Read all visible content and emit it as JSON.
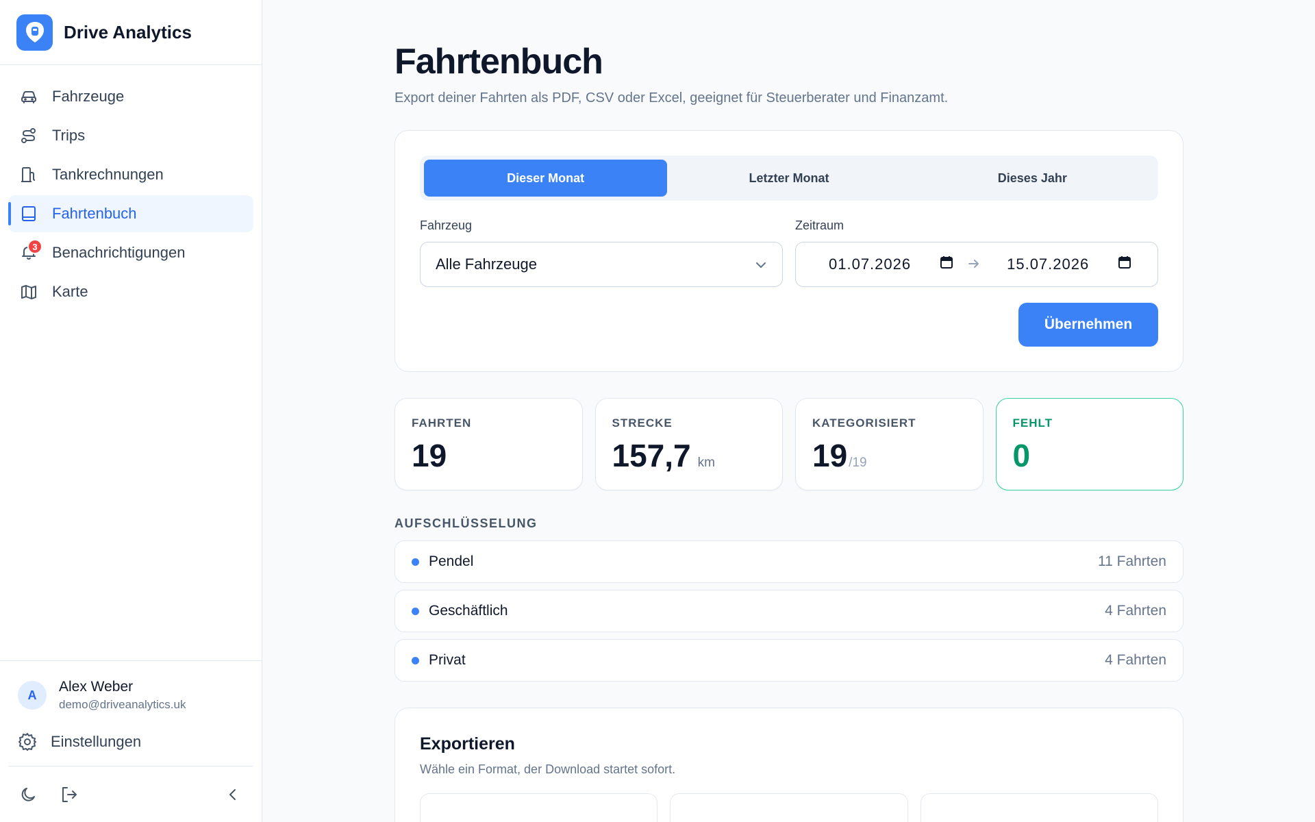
{
  "app": {
    "name": "Drive Analytics",
    "accent": "#3b82f6"
  },
  "sidebar": {
    "items": [
      {
        "label": "Fahrzeuge",
        "icon": "car-icon"
      },
      {
        "label": "Trips",
        "icon": "route-icon"
      },
      {
        "label": "Tankrechnungen",
        "icon": "fuel-icon"
      },
      {
        "label": "Fahrtenbuch",
        "icon": "book-icon",
        "active": true
      },
      {
        "label": "Benachrichtigungen",
        "icon": "bell-icon",
        "badge": "3"
      },
      {
        "label": "Karte",
        "icon": "map-icon"
      }
    ],
    "user": {
      "initial": "A",
      "name": "Alex Weber",
      "email": "demo@driveanalytics.uk"
    },
    "settings_label": "Einstellungen"
  },
  "page": {
    "title": "Fahrtenbuch",
    "subtitle": "Export deiner Fahrten als PDF, CSV oder Excel, geeignet für Steuerberater und Finanzamt."
  },
  "filter": {
    "tabs": [
      "Dieser Monat",
      "Letzter Monat",
      "Dieses Jahr"
    ],
    "active_tab": 0,
    "vehicle_label": "Fahrzeug",
    "vehicle_value": "Alle Fahrzeuge",
    "range_label": "Zeitraum",
    "date_from": "01.07.2026",
    "date_to": "15.07.2026",
    "apply_label": "Übernehmen"
  },
  "stats": [
    {
      "label": "FAHRTEN",
      "value": "19"
    },
    {
      "label": "STRECKE",
      "value": "157,7",
      "unit": "km"
    },
    {
      "label": "KATEGORISIERT",
      "value": "19",
      "suffix": "/19"
    },
    {
      "label": "FEHLT",
      "value": "0",
      "color": "#059669"
    }
  ],
  "breakdown": {
    "title": "AUFSCHLÜSSELUNG",
    "rows": [
      {
        "label": "Pendel",
        "count": "11 Fahrten"
      },
      {
        "label": "Geschäftlich",
        "count": "4 Fahrten"
      },
      {
        "label": "Privat",
        "count": "4 Fahrten"
      }
    ]
  },
  "export": {
    "title": "Exportieren",
    "subtitle": "Wähle ein Format, der Download startet sofort."
  }
}
